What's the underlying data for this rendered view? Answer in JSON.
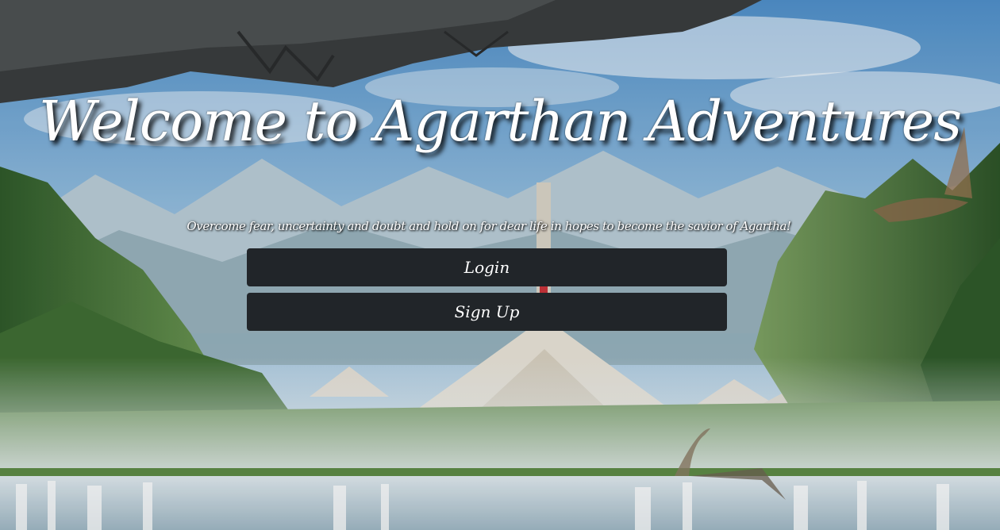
{
  "hero": {
    "title": "Welcome to Agarthan Adventures",
    "tagline": "Overcome fear, uncertainty and doubt and hold on for dear life in hopes to become the savior of Agartha!"
  },
  "actions": {
    "login_label": "Login",
    "signup_label": "Sign Up"
  },
  "colors": {
    "button_bg": "#212529",
    "text": "#ffffff"
  },
  "background": {
    "scene": "fantasy-valley-with-pyramids-and-waterfalls"
  }
}
